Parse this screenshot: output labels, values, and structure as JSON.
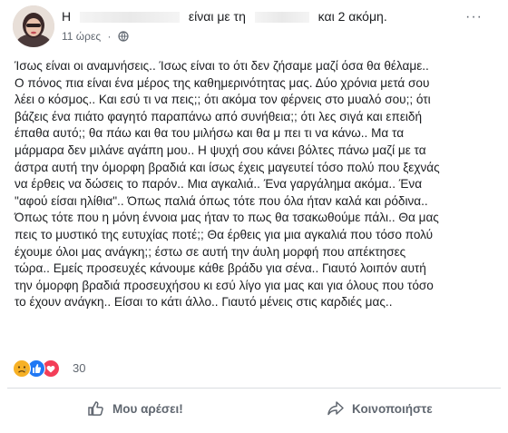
{
  "post": {
    "author_start": "Η",
    "author_middle": "είναι με τη",
    "author_end": "και 2 ακόμη.",
    "time": "11 ώρες",
    "privacy_icon": "globe-icon",
    "text_lines": [
      "Ίσως είναι οι αναμνήσεις.. Ίσως είναι το ότι δεν ζήσαμε μαζί όσα θα θέλαμε..",
      "Ο πόνος πια είναι ένα μέρος της καθημερινότητας μας. Δύο χρόνια μετά σου",
      "λέει ο κόσμος.. Και εσύ τι να πεις;; ότι ακόμα τον φέρνεις στο μυαλό σου;; ότι",
      "βάζεις ένα πιάτο φαγητό παραπάνω από συνήθεια;; ότι λες σιγά και επειδή",
      "έπαθα αυτό;; θα πάω και θα του μιλήσω και θα μ πει τι να κάνω.. Μα τα",
      "μάρμαρα δεν μιλάνε αγάπη μου.. Η ψυχή σου κάνει βόλτες πάνω μαζί με τα",
      "άστρα αυτή την όμορφη βραδιά και ίσως έχεις μαγευτεί τόσο πολύ που ξεχνάς",
      "να έρθεις να δώσεις το παρόν.. Μια αγκαλιά.. Ένα γαργάλημα ακόμα.. Ένα",
      "\"αφού είσαι ηλίθια\".. Όπως παλιά όπως τότε που όλα ήταν καλά και ρόδινα..",
      "Όπως τότε που η μόνη έννοια μας ήταν το πως θα τσακωθούμε πάλι.. Θα μας",
      "πεις το μυστικό της ευτυχίας ποτέ;; Θα έρθεις για μια αγκαλιά που τόσο πολύ",
      "έχουμε όλοι μας ανάγκη;; έστω σε αυτή την άυλη μορφή που απέκτησες",
      "τώρα.. Εμείς προσευχές κάνουμε κάθε βράδυ για σένα.. Γιαυτό λοιπόν αυτή",
      "την όμορφη βραδιά προσευχήσου κι εσύ λίγο για μας και για όλους που τόσο",
      "το έχουν ανάγκη.. Είσαι το κάτι άλλο.. Γιαυτό μένεις στις καρδιές μας.."
    ]
  },
  "reactions": {
    "icons": [
      "sad-reaction-icon",
      "like-reaction-icon",
      "love-reaction-icon"
    ],
    "count": "30"
  },
  "actions": {
    "like_label": "Μου αρέσει!",
    "share_label": "Κοινοποιήστε"
  },
  "colors": {
    "text": "#1c1e21",
    "meta": "#606770",
    "like_blue": "#2078f4",
    "love_red": "#f33e58",
    "sad_yellow": "#f7b125",
    "divider": "#dadde1"
  }
}
